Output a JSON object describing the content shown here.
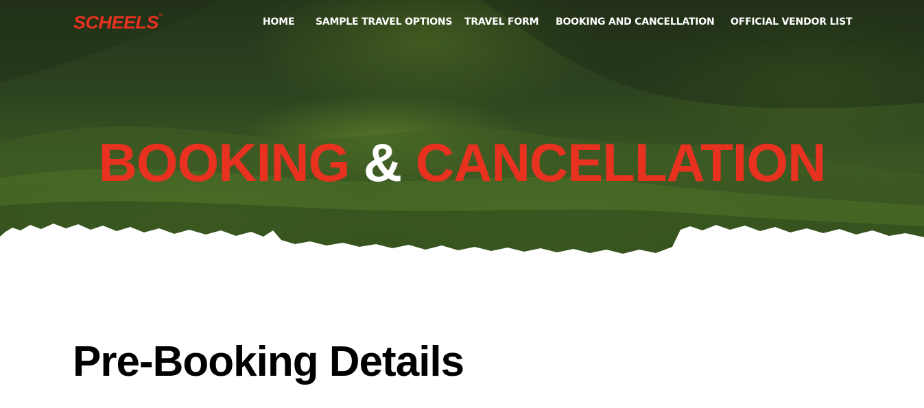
{
  "brand": {
    "name": "SCHEELS",
    "registered_mark": "®",
    "color": "#e8321f"
  },
  "nav": {
    "items": [
      {
        "label": "HOME"
      },
      {
        "label": "SAMPLE TRAVEL OPTIONS"
      },
      {
        "label": "TRAVEL FORM"
      },
      {
        "label": "BOOKING AND CANCELLATION"
      },
      {
        "label": "OFFICIAL VENDOR LIST"
      }
    ]
  },
  "hero": {
    "title_part1": "BOOKING",
    "title_amp": "&",
    "title_part2": "CANCELLATION",
    "background": "green-hills-landscape",
    "accent_color": "#e8321f"
  },
  "main": {
    "section_title": "Pre-Booking Details"
  }
}
